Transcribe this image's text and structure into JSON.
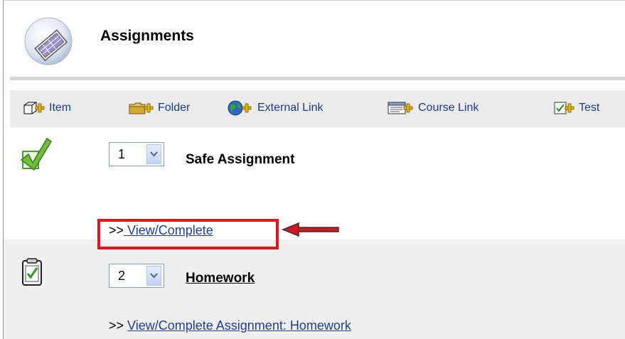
{
  "header": {
    "title": "Assignments"
  },
  "toolbar": {
    "item": "Item",
    "folder": "Folder",
    "external_link": "External Link",
    "course_link": "Course Link",
    "test": "Test"
  },
  "rows": [
    {
      "order": "1",
      "title": "Safe Assignment",
      "link_prefix": ">>",
      "link_text": " View/Complete"
    },
    {
      "order": "2",
      "title": "Homework",
      "link_prefix": ">>",
      "link_text": "View/Complete Assignment: Homework"
    }
  ],
  "colors": {
    "highlight": "#e3141b",
    "link": "#1c3f94"
  }
}
